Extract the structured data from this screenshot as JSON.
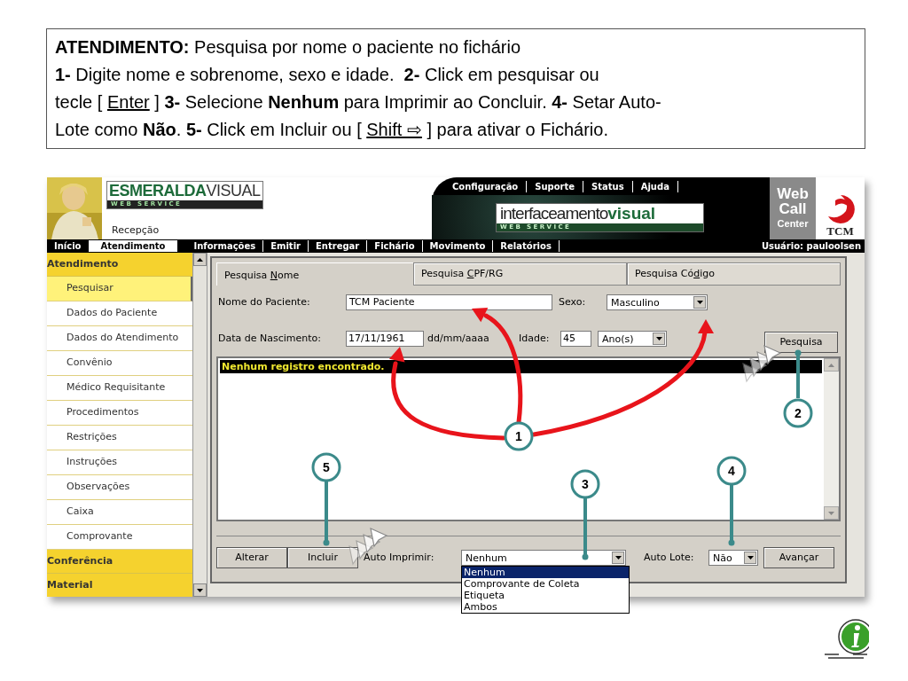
{
  "caption": {
    "lines": [
      [
        {
          "kind": "text",
          "text": "**ATENDIMENTO:** Pesquisa por nome o paciente no fichário"
        }
      ],
      [
        {
          "kind": "text",
          "text": "**1-** Digite nome e sobrenome, sexo e idade.  **2-** Click em pesquisar ou"
        }
      ],
      [
        {
          "kind": "text",
          "text": "tecle [ "
        },
        {
          "kind": "key",
          "text": "Enter"
        },
        {
          "kind": "text",
          "text": " ] **3-** Selecione **Nenhum** para Imprimir ao Concluir. **4-** Setar Auto-"
        }
      ],
      [
        {
          "kind": "text",
          "text": "Lote como **Não**. **5-** Click em Incluir ou [ "
        },
        {
          "kind": "key",
          "text": "Shift ⇨"
        },
        {
          "kind": "text",
          "text": " ] para ativar o Fichário."
        }
      ]
    ]
  },
  "header": {
    "brand": {
      "name": "ESMERALDA",
      "name2": "VISUAL",
      "tagline": "W E B   S E R V I C E"
    },
    "module": "Recepção",
    "top_links": [
      "Configuração",
      "Suporte",
      "Status",
      "Ajuda"
    ],
    "partner_logo": {
      "name": "interfaceamento",
      "name2": "visual",
      "tagline": "W E B   S E R V I C E"
    },
    "callcenter": {
      "lines": [
        "Web",
        "Call",
        "Center"
      ],
      "tcm": "TCM"
    }
  },
  "menu": {
    "items": [
      {
        "label": "Início",
        "selected": false
      },
      {
        "label": "Atendimento",
        "selected": true
      },
      {
        "label": "Informações",
        "selected": false
      },
      {
        "label": "Emitir",
        "selected": false
      },
      {
        "label": "Entregar",
        "selected": false
      },
      {
        "label": "Fichário",
        "selected": false
      },
      {
        "label": "Movimento",
        "selected": false
      },
      {
        "label": "Relatórios",
        "selected": false
      }
    ],
    "user": "Usuário: pauloolsen"
  },
  "sidebar": {
    "groups": [
      {
        "label": "Atendimento",
        "children": [
          {
            "label": "Pesquisar",
            "selected": true
          },
          {
            "label": "Dados do Paciente",
            "selected": false
          },
          {
            "label": "Dados do Atendimento",
            "selected": false
          },
          {
            "label": "Convênio",
            "selected": false
          },
          {
            "label": "Médico Requisitante",
            "selected": false
          },
          {
            "label": "Procedimentos",
            "selected": false
          },
          {
            "label": "Restrições",
            "selected": false
          },
          {
            "label": "Instruções",
            "selected": false
          },
          {
            "label": "Observações",
            "selected": false
          },
          {
            "label": "Caixa",
            "selected": false
          },
          {
            "label": "Comprovante",
            "selected": false
          }
        ]
      },
      {
        "label": "Conferência"
      },
      {
        "label": "Material"
      }
    ]
  },
  "tabs": [
    {
      "before": "Pesquisa ",
      "key": "N",
      "after": "ome",
      "selected": true
    },
    {
      "before": "Pesquisa ",
      "key": "C",
      "after": "PF/RG",
      "selected": false
    },
    {
      "before": "Pesquisa Có",
      "key": "d",
      "after": "igo",
      "selected": false
    }
  ],
  "form": {
    "name_label": "Nome do Paciente:",
    "name_value": "TCM Paciente",
    "sex_label": "Sexo:",
    "sex_value": "Masculino",
    "birth_label": "Data de Nascimento:",
    "birth_value": "17/11/1961",
    "date_hint": "dd/mm/aaaa",
    "age_label": "Idade:",
    "age_value": "45",
    "age_unit": "Ano(s)",
    "search_button": "Pesquisa"
  },
  "results": {
    "message": "Nenhum registro encontrado."
  },
  "footer": {
    "buttons": [
      "Alterar",
      "Incluir"
    ],
    "auto_print": {
      "label": "Auto Imprimir:",
      "value": "Nenhum",
      "expanded": true,
      "options": [
        {
          "label": "Nenhum",
          "selected": true
        },
        {
          "label": "Comprovante de Coleta",
          "selected": false
        },
        {
          "label": "Etiqueta",
          "selected": false
        },
        {
          "label": "Ambos",
          "selected": false
        }
      ]
    },
    "auto_batch": {
      "label": "Auto Lote:",
      "value": "Não"
    },
    "next_button": "Avançar"
  },
  "annotations": {
    "callouts": [
      {
        "number": "1"
      },
      {
        "number": "2"
      },
      {
        "number": "3"
      },
      {
        "number": "4"
      },
      {
        "number": "5"
      }
    ]
  }
}
